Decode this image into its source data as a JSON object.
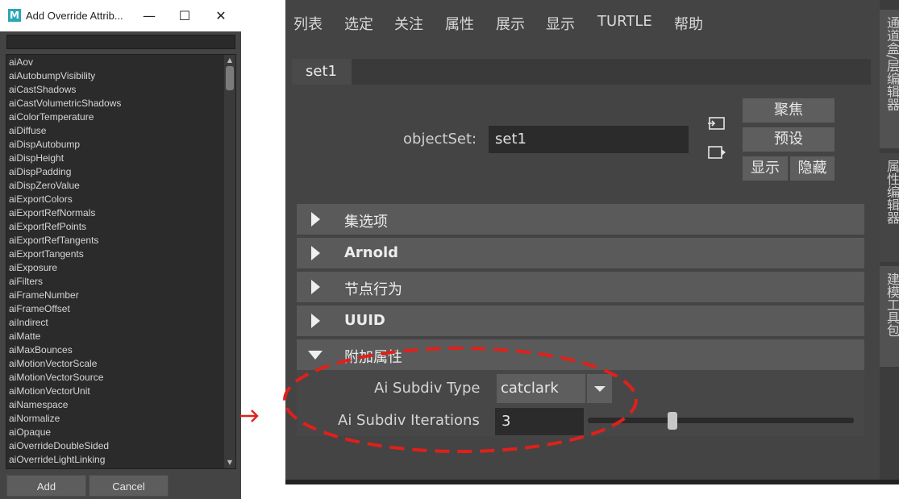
{
  "dialog": {
    "title": "Add Override Attrib...",
    "logo": "M",
    "window_controls": {
      "minimize": "—",
      "maximize": "☐",
      "close": "✕"
    },
    "items": [
      "aiAov",
      "aiAutobumpVisibility",
      "aiCastShadows",
      "aiCastVolumetricShadows",
      "aiColorTemperature",
      "aiDiffuse",
      "aiDispAutobump",
      "aiDispHeight",
      "aiDispPadding",
      "aiDispZeroValue",
      "aiExportColors",
      "aiExportRefNormals",
      "aiExportRefPoints",
      "aiExportRefTangents",
      "aiExportTangents",
      "aiExposure",
      "aiFilters",
      "aiFrameNumber",
      "aiFrameOffset",
      "aiIndirect",
      "aiMatte",
      "aiMaxBounces",
      "aiMotionVectorScale",
      "aiMotionVectorSource",
      "aiMotionVectorUnit",
      "aiNamespace",
      "aiNormalize",
      "aiOpaque",
      "aiOverrideDoubleSided",
      "aiOverrideLightLinking"
    ],
    "add_label": "Add",
    "cancel_label": "Cancel"
  },
  "editor": {
    "menus": [
      "列表",
      "选定",
      "关注",
      "属性",
      "展示",
      "显示",
      "TURTLE",
      "帮助"
    ],
    "tab": "set1",
    "object_set_label": "objectSet:",
    "object_set_value": "set1",
    "buttons": {
      "focus": "聚焦",
      "presets": "预设",
      "show": "显示",
      "hide": "隐藏"
    },
    "sections": [
      {
        "label": "集选项",
        "expanded": false
      },
      {
        "label": "Arnold",
        "expanded": false
      },
      {
        "label": "节点行为",
        "expanded": false
      },
      {
        "label": "UUID",
        "expanded": false
      },
      {
        "label": "附加属性",
        "expanded": true
      }
    ],
    "attributes": {
      "subdiv_type_label": "Ai Subdiv Type",
      "subdiv_type_value": "catclark",
      "subdiv_iterations_label": "Ai Subdiv Iterations",
      "subdiv_iterations_value": "3",
      "slider_fraction": 0.31
    },
    "side_tabs": [
      "通道盒/层编辑器",
      "属性编辑器",
      "建模工具包"
    ]
  },
  "colors": {
    "annotation": "#e0201a",
    "panel": "#444444"
  },
  "icons": [
    "arrow-right-icon",
    "load-icon",
    "select-icon",
    "triangle-right-icon",
    "triangle-down-icon",
    "dropdown-arrow-icon"
  ]
}
